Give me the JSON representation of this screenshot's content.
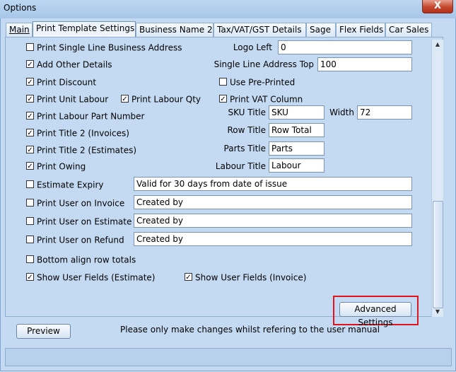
{
  "window": {
    "title": "Options",
    "close_glyph": "X"
  },
  "tabs": [
    {
      "label": "Main",
      "active": false
    },
    {
      "label": "Print Template Settings",
      "active": true
    },
    {
      "label": "Business Name 2",
      "active": false
    },
    {
      "label": "Tax/VAT/GST Details",
      "active": false
    },
    {
      "label": "Sage",
      "active": false
    },
    {
      "label": "Flex Fields",
      "active": false
    },
    {
      "label": "Car Sales",
      "active": false
    }
  ],
  "checkboxes": {
    "single_line_business_address": {
      "label": "Print Single Line Business Address",
      "checked": false
    },
    "add_other_details": {
      "label": "Add Other Details",
      "checked": true
    },
    "print_discount": {
      "label": "Print Discount",
      "checked": true
    },
    "print_unit_labour": {
      "label": "Print Unit Labour",
      "checked": true
    },
    "print_labour_qty": {
      "label": "Print Labour Qty",
      "checked": true
    },
    "print_vat_column": {
      "label": "Print VAT Column",
      "checked": true
    },
    "use_pre_printed": {
      "label": "Use Pre-Printed",
      "checked": false
    },
    "print_labour_part_number": {
      "label": "Print Labour Part Number",
      "checked": true
    },
    "print_title2_invoices": {
      "label": "Print Title 2 (Invoices)",
      "checked": true
    },
    "print_title2_estimates": {
      "label": "Print Title 2 (Estimates)",
      "checked": true
    },
    "print_owing": {
      "label": "Print Owing",
      "checked": true
    },
    "estimate_expiry": {
      "label": "Estimate Expiry",
      "checked": false
    },
    "print_user_invoice": {
      "label": "Print User on Invoice",
      "checked": false
    },
    "print_user_estimate": {
      "label": "Print User on Estimate",
      "checked": false
    },
    "print_user_refund": {
      "label": "Print User on Refund",
      "checked": false
    },
    "bottom_align_row_totals": {
      "label": "Bottom align row totals",
      "checked": false
    },
    "show_user_fields_estimate": {
      "label": "Show User Fields (Estimate)",
      "checked": true
    },
    "show_user_fields_invoice": {
      "label": "Show User Fields (Invoice)",
      "checked": true
    }
  },
  "fields": {
    "logo_left": {
      "label": "Logo Left",
      "value": "0"
    },
    "single_line_address_top": {
      "label": "Single Line Address Top",
      "value": "100"
    },
    "sku_title": {
      "label": "SKU Title",
      "value": "SKU"
    },
    "width": {
      "label": "Width",
      "value": "72"
    },
    "row_title": {
      "label": "Row Title",
      "value": "Row Total"
    },
    "parts_title": {
      "label": "Parts Title",
      "value": "Parts"
    },
    "labour_title": {
      "label": "Labour Title",
      "value": "Labour"
    },
    "estimate_expiry_text": {
      "value": "Valid for 30 days from date of issue"
    },
    "user_invoice_text": {
      "value": "Created by"
    },
    "user_estimate_text": {
      "value": "Created by"
    },
    "user_refund_text": {
      "value": "Created by"
    }
  },
  "buttons": {
    "advanced_settings": "Advanced Settings",
    "preview": "Preview"
  },
  "notice": "Please only make changes whilst refering to the user manual",
  "accent": {
    "highlight": "#e0141e",
    "window_bg": "#c4daf2",
    "close_red": "#c4482d"
  }
}
